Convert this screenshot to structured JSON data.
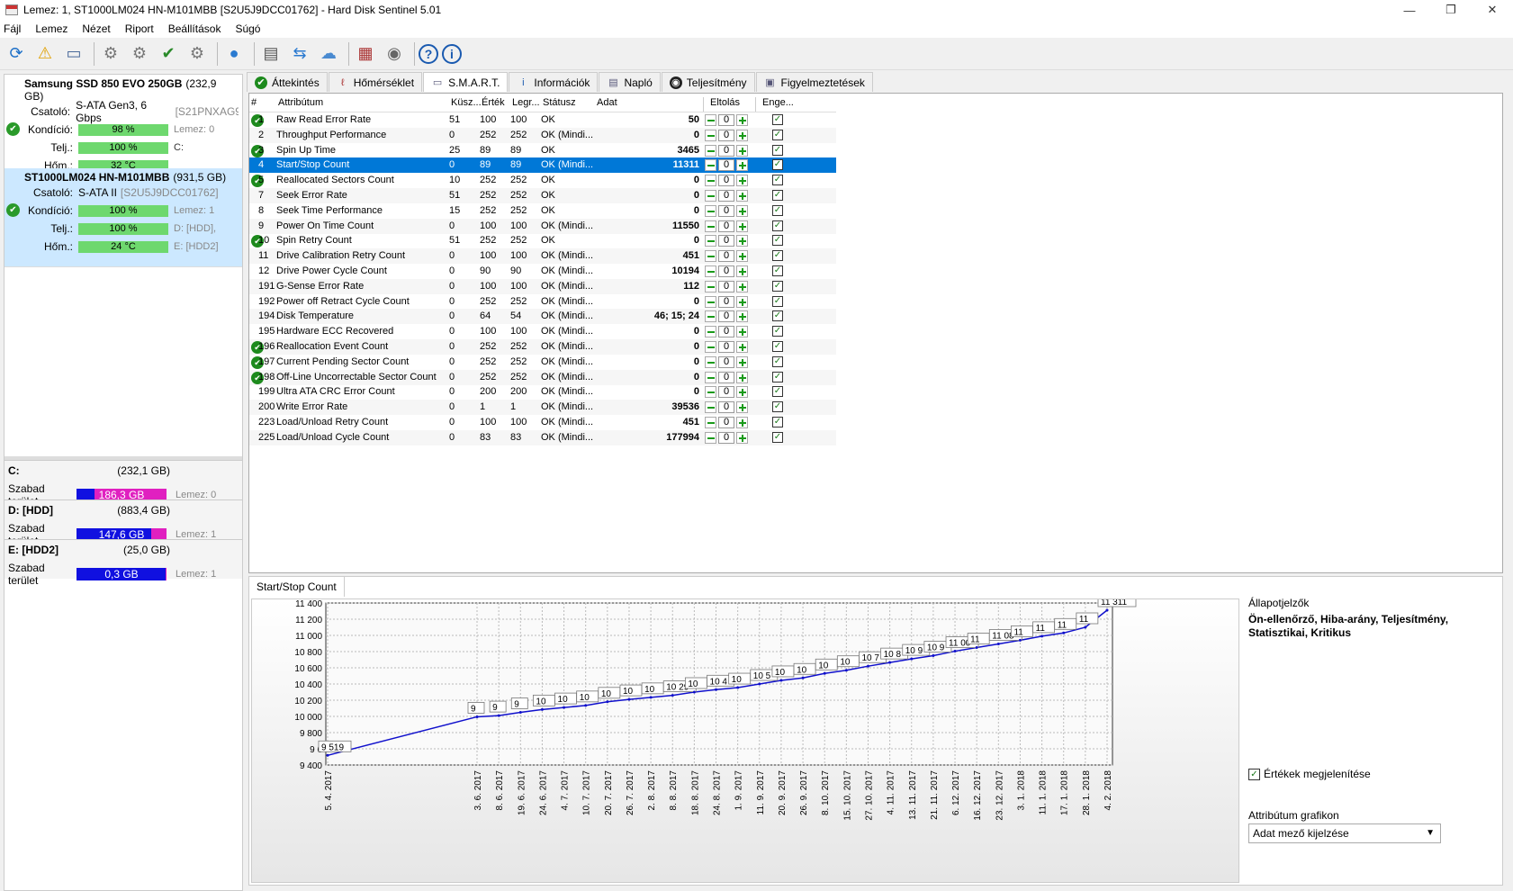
{
  "window": {
    "title": "Lemez: 1, ST1000LM024 HN-M101MBB [S2U5J9DCC01762]  -  Hard Disk Sentinel 5.01",
    "minimize": "—",
    "maximize": "❐",
    "close": "✕"
  },
  "menu": [
    "Fájl",
    "Lemez",
    "Nézet",
    "Riport",
    "Beállítások",
    "Súgó"
  ],
  "toolbar_icons": [
    "refresh-icon",
    "alert-icon",
    "disk-icon",
    "disk-tool-icon",
    "disk-tool-icon",
    "disk-check-icon",
    "disk-tool-icon",
    "globe-icon",
    "report-icon",
    "send-icon",
    "network-icon",
    "chart-icon",
    "speaker-icon",
    "help-icon",
    "info-icon"
  ],
  "disks": [
    {
      "name": "Samsung SSD 850 EVO 250GB",
      "size": "(232,9 GB)",
      "conn_label": "Csatoló:",
      "conn": "S-ATA Gen3, 6 Gbps",
      "serial": "[S21PNXAG9",
      "rows": [
        {
          "label": "Kondíció:",
          "value": "98 %",
          "extra": "Lemez: 0"
        },
        {
          "label": "Telj.:",
          "value": "100 %",
          "extra": "C:"
        },
        {
          "label": "Hőm.:",
          "value": "32 °C",
          "extra": ""
        }
      ]
    },
    {
      "name": "ST1000LM024 HN-M101MBB",
      "size": "(931,5 GB)",
      "conn_label": "Csatoló:",
      "conn": "S-ATA II",
      "serial": "[S2U5J9DCC01762]",
      "rows": [
        {
          "label": "Kondíció:",
          "value": "100 %",
          "extra": "Lemez: 1"
        },
        {
          "label": "Telj.:",
          "value": "100 %",
          "extra": "D: [HDD],"
        },
        {
          "label": "Hőm.:",
          "value": "24 °C",
          "extra": "E: [HDD2]"
        }
      ]
    }
  ],
  "volumes": [
    {
      "name": "C:",
      "size": "(232,1 GB)",
      "free_label": "Szabad terület",
      "free": "186,3 GB",
      "free_frac": 0.2,
      "disk": "Lemez: 0"
    },
    {
      "name": "D: [HDD]",
      "size": "(883,4 GB)",
      "free_label": "Szabad terület",
      "free": "147,6 GB",
      "free_frac": 0.83,
      "disk": "Lemez: 1"
    },
    {
      "name": "E: [HDD2]",
      "size": "(25,0 GB)",
      "free_label": "Szabad terület",
      "free": "0,3 GB",
      "free_frac": 0.99,
      "disk": "Lemez: 1"
    }
  ],
  "tabs": [
    {
      "label": "Áttekintés",
      "icon": "check-icon"
    },
    {
      "label": "Hőmérséklet",
      "icon": "thermometer-icon"
    },
    {
      "label": "S.M.A.R.T.",
      "icon": "disk-icon"
    },
    {
      "label": "Információk",
      "icon": "info-icon"
    },
    {
      "label": "Napló",
      "icon": "log-icon"
    },
    {
      "label": "Teljesítmény",
      "icon": "gauge-icon"
    },
    {
      "label": "Figyelmeztetések",
      "icon": "warning-doc-icon"
    }
  ],
  "smart": {
    "headers": {
      "num": "#",
      "attr": "Attribútum",
      "thr": "Küsz...",
      "val": "Érték",
      "worst": "Legr...",
      "status": "Státusz",
      "data": "Adat",
      "offset": "Eltolás",
      "enable": "Enge..."
    },
    "rows": [
      {
        "id": "1",
        "name": "Raw Read Error Rate",
        "thr": "51",
        "val": "100",
        "worst": "100",
        "status": "OK",
        "data": "50",
        "ok": true
      },
      {
        "id": "2",
        "name": "Throughput Performance",
        "thr": "0",
        "val": "252",
        "worst": "252",
        "status": "OK (Mindi...",
        "data": "0",
        "ok": false
      },
      {
        "id": "3",
        "name": "Spin Up Time",
        "thr": "25",
        "val": "89",
        "worst": "89",
        "status": "OK",
        "data": "3465",
        "ok": true
      },
      {
        "id": "4",
        "name": "Start/Stop Count",
        "thr": "0",
        "val": "89",
        "worst": "89",
        "status": "OK (Mindi...",
        "data": "11311",
        "ok": false,
        "selected": true
      },
      {
        "id": "5",
        "name": "Reallocated Sectors Count",
        "thr": "10",
        "val": "252",
        "worst": "252",
        "status": "OK",
        "data": "0",
        "ok": true
      },
      {
        "id": "7",
        "name": "Seek Error Rate",
        "thr": "51",
        "val": "252",
        "worst": "252",
        "status": "OK",
        "data": "0",
        "ok": false
      },
      {
        "id": "8",
        "name": "Seek Time Performance",
        "thr": "15",
        "val": "252",
        "worst": "252",
        "status": "OK",
        "data": "0",
        "ok": false
      },
      {
        "id": "9",
        "name": "Power On Time Count",
        "thr": "0",
        "val": "100",
        "worst": "100",
        "status": "OK (Mindi...",
        "data": "11550",
        "ok": false
      },
      {
        "id": "10",
        "name": "Spin Retry Count",
        "thr": "51",
        "val": "252",
        "worst": "252",
        "status": "OK",
        "data": "0",
        "ok": true
      },
      {
        "id": "11",
        "name": "Drive Calibration Retry Count",
        "thr": "0",
        "val": "100",
        "worst": "100",
        "status": "OK (Mindi...",
        "data": "451",
        "ok": false
      },
      {
        "id": "12",
        "name": "Drive Power Cycle Count",
        "thr": "0",
        "val": "90",
        "worst": "90",
        "status": "OK (Mindi...",
        "data": "10194",
        "ok": false
      },
      {
        "id": "191",
        "name": "G-Sense Error Rate",
        "thr": "0",
        "val": "100",
        "worst": "100",
        "status": "OK (Mindi...",
        "data": "112",
        "ok": false
      },
      {
        "id": "192",
        "name": "Power off Retract Cycle Count",
        "thr": "0",
        "val": "252",
        "worst": "252",
        "status": "OK (Mindi...",
        "data": "0",
        "ok": false
      },
      {
        "id": "194",
        "name": "Disk Temperature",
        "thr": "0",
        "val": "64",
        "worst": "54",
        "status": "OK (Mindi...",
        "data": "46; 15; 24",
        "ok": false
      },
      {
        "id": "195",
        "name": "Hardware ECC Recovered",
        "thr": "0",
        "val": "100",
        "worst": "100",
        "status": "OK (Mindi...",
        "data": "0",
        "ok": false
      },
      {
        "id": "196",
        "name": "Reallocation Event Count",
        "thr": "0",
        "val": "252",
        "worst": "252",
        "status": "OK (Mindi...",
        "data": "0",
        "ok": true
      },
      {
        "id": "197",
        "name": "Current Pending Sector Count",
        "thr": "0",
        "val": "252",
        "worst": "252",
        "status": "OK (Mindi...",
        "data": "0",
        "ok": true
      },
      {
        "id": "198",
        "name": "Off-Line Uncorrectable Sector Count",
        "thr": "0",
        "val": "252",
        "worst": "252",
        "status": "OK (Mindi...",
        "data": "0",
        "ok": true
      },
      {
        "id": "199",
        "name": "Ultra ATA CRC Error Count",
        "thr": "0",
        "val": "200",
        "worst": "200",
        "status": "OK (Mindi...",
        "data": "0",
        "ok": false
      },
      {
        "id": "200",
        "name": "Write Error Rate",
        "thr": "0",
        "val": "1",
        "worst": "1",
        "status": "OK (Mindi...",
        "data": "39536",
        "ok": false
      },
      {
        "id": "223",
        "name": "Load/Unload Retry Count",
        "thr": "0",
        "val": "100",
        "worst": "100",
        "status": "OK (Mindi...",
        "data": "451",
        "ok": false
      },
      {
        "id": "225",
        "name": "Load/Unload Cycle Count",
        "thr": "0",
        "val": "83",
        "worst": "83",
        "status": "OK (Mindi...",
        "data": "177994",
        "ok": false
      }
    ],
    "offset_value": "0",
    "check": "✓"
  },
  "graph": {
    "tab": "Start/Stop Count",
    "side_title": "Állapotjelzők",
    "side_body": "Ön-ellenőrző, Hiba-arány, Teljesítmény, Statisztikai, Kritikus",
    "show_values": "Értékek megjelenítése",
    "attr_graph_label": "Attribútum grafikon",
    "attr_graph_value": "Adat mező kijelzése"
  },
  "chart_data": {
    "type": "line",
    "ylim": [
      9400,
      11400
    ],
    "yticks": [
      "9 400",
      "9 6",
      "9 800",
      "10 000",
      "10 200",
      "10 400",
      "10 600",
      "10 800",
      "11 000",
      "11 200",
      "11 400"
    ],
    "ytick_values": [
      9400,
      9600,
      9800,
      10000,
      10200,
      10400,
      10600,
      10800,
      11000,
      11200,
      11400
    ],
    "x": [
      "5. 4. 2017",
      "3. 6. 2017",
      "8. 6. 2017",
      "19. 6. 2017",
      "24. 6. 2017",
      "4. 7. 2017",
      "10. 7. 2017",
      "20. 7. 2017",
      "26. 7. 2017",
      "2. 8. 2017",
      "8. 8. 2017",
      "18. 8. 2017",
      "24. 8. 2017",
      "1. 9. 2017",
      "11. 9. 2017",
      "20. 9. 2017",
      "26. 9. 2017",
      "8. 10. 2017",
      "15. 10. 2017",
      "27. 10. 2017",
      "4. 11. 2017",
      "13. 11. 2017",
      "21. 11. 2017",
      "6. 12. 2017",
      "16. 12. 2017",
      "23. 12. 2017",
      "3. 1. 2018",
      "11. 1. 2018",
      "17. 1. 2018",
      "28. 1. 2018",
      "4. 2. 2018"
    ],
    "values": [
      9519,
      9995,
      10010,
      10050,
      10085,
      10110,
      10135,
      10180,
      10210,
      10235,
      10260,
      10300,
      10330,
      10355,
      10400,
      10445,
      10475,
      10530,
      10570,
      10620,
      10665,
      10710,
      10750,
      10805,
      10850,
      10895,
      10940,
      10990,
      11030,
      11100,
      11311
    ],
    "labels": [
      "9 519",
      "9 ",
      "9 ",
      "9 ",
      "10 ",
      "10 ",
      "10 ",
      "10 ",
      "10 ",
      "10 ",
      "10 29",
      "10 ",
      "10 4",
      "10 ",
      "10 5",
      "10 ",
      "10 ",
      "10 ",
      "10 ",
      "10 7",
      "10 8",
      "10 9",
      "10 9",
      "11 00",
      "11 ",
      "11 08",
      "11 ",
      "11 ",
      "11 ",
      "11 ",
      "11 311"
    ]
  }
}
